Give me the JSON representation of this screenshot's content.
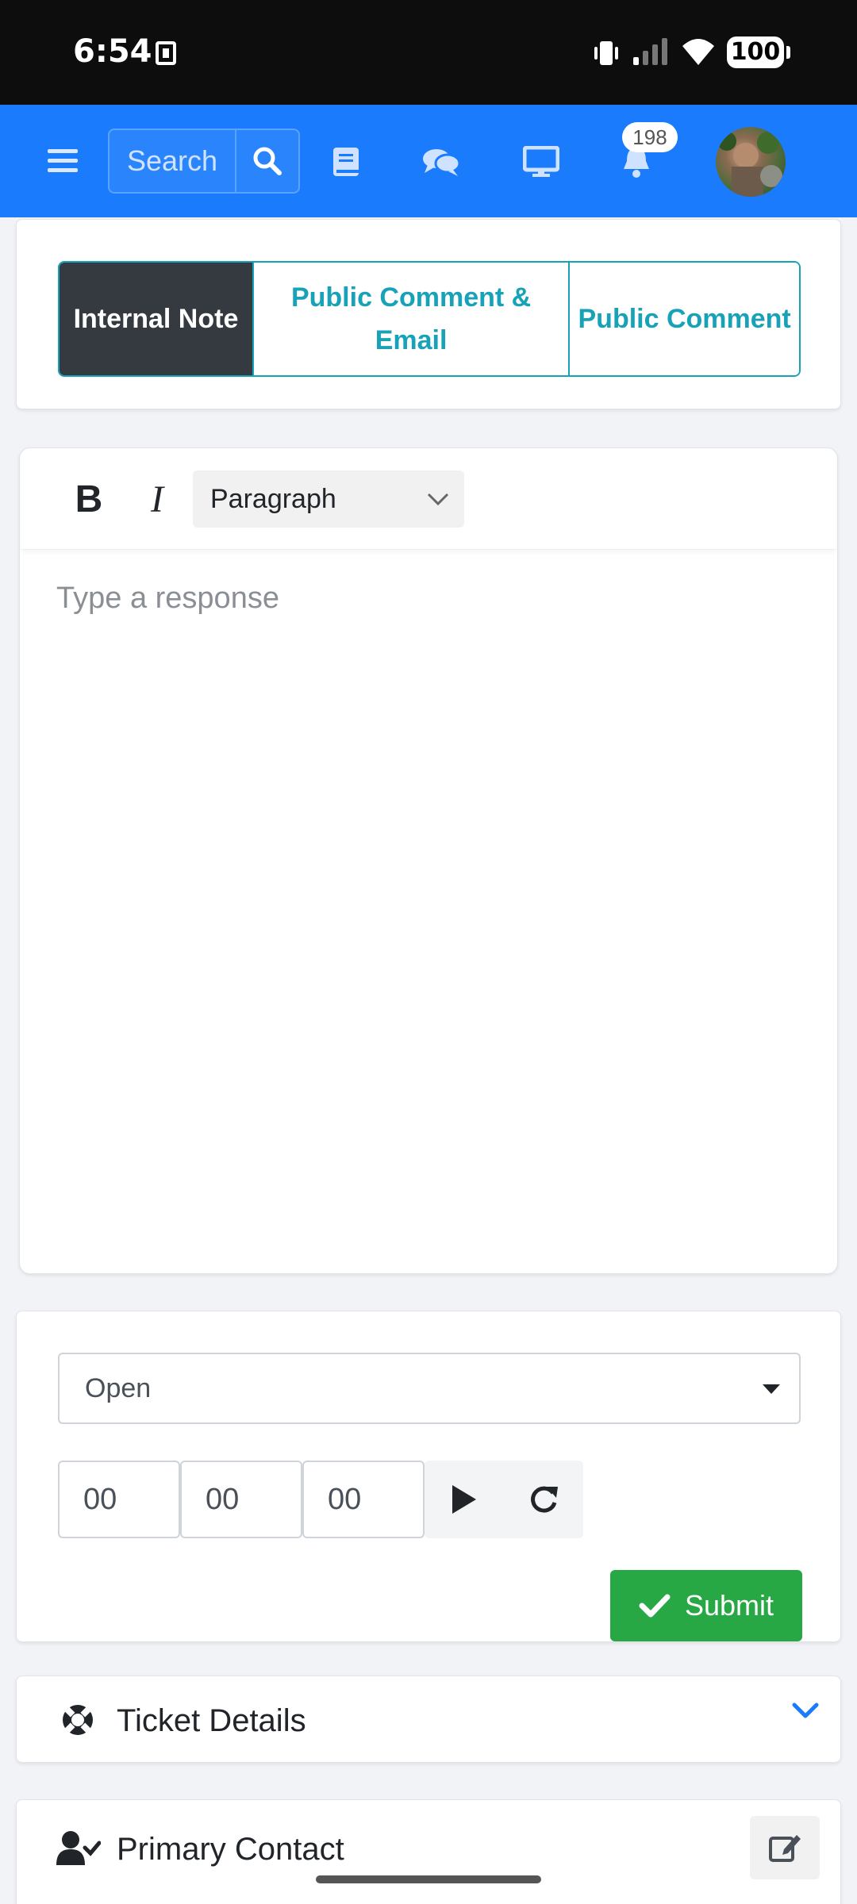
{
  "status_bar": {
    "time": "6:54",
    "battery": "100"
  },
  "navbar": {
    "search_placeholder": "Search",
    "notification_count": "198"
  },
  "reply_tabs": [
    {
      "label": "Internal Note",
      "active": true
    },
    {
      "label": "Public Comment & Email",
      "active": false
    },
    {
      "label": "Public Comment",
      "active": false
    }
  ],
  "editor": {
    "bold_label": "B",
    "italic_label": "I",
    "block_format": "Paragraph",
    "placeholder": "Type a response"
  },
  "ticket_status": {
    "selected": "Open"
  },
  "timer": {
    "hours": "00",
    "minutes": "00",
    "seconds": "00"
  },
  "submit_label": "Submit",
  "sections": {
    "ticket_details": "Ticket Details",
    "primary_contact": "Primary Contact"
  },
  "colors": {
    "navbar": "#1a7cfc",
    "tab_accent": "#17a2b8",
    "tab_active": "#343a40",
    "submit": "#28a745"
  }
}
